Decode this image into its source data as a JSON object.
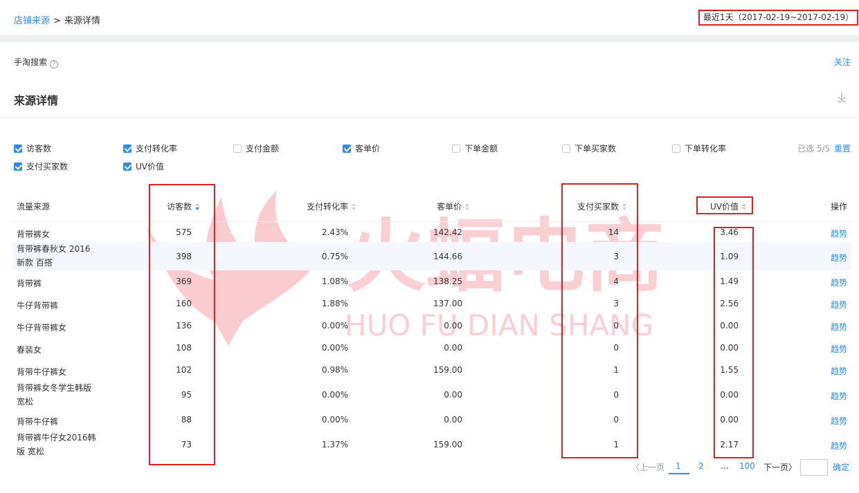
{
  "breadcrumb": {
    "parent": "店铺来源",
    "separator": ">",
    "current": "来源详情"
  },
  "date_range": "最近1天（2017-02-19~2017-02-19）",
  "section": {
    "name": "手淘搜索",
    "help": "?",
    "follow": "关注"
  },
  "title": "来源详情",
  "metrics": [
    {
      "label": "访客数",
      "checked": true
    },
    {
      "label": "支付转化率",
      "checked": true
    },
    {
      "label": "支付金额",
      "checked": false
    },
    {
      "label": "客单价",
      "checked": true
    },
    {
      "label": "下单金额",
      "checked": false
    },
    {
      "label": "下单买家数",
      "checked": false
    },
    {
      "label": "下单转化率",
      "checked": false
    },
    {
      "label": "支付买家数",
      "checked": true
    },
    {
      "label": "UV价值",
      "checked": true
    }
  ],
  "selected_count": "已选 5/5",
  "reset": "重置",
  "columns": [
    "流量来源",
    "访客数",
    "支付转化率",
    "客单价",
    "支付买家数",
    "UV价值",
    "操作"
  ],
  "rows": [
    {
      "source": "背带裤女",
      "visitors": "575",
      "conv": "2.43%",
      "aov": "142.42",
      "buyers": "14",
      "uv": "3.46",
      "action": "趋势"
    },
    {
      "source": "背带裤春秋女 2016 新款 百搭",
      "visitors": "398",
      "conv": "0.75%",
      "aov": "144.66",
      "buyers": "3",
      "uv": "1.09",
      "action": "趋势"
    },
    {
      "source": "背带裤",
      "visitors": "369",
      "conv": "1.08%",
      "aov": "138.25",
      "buyers": "4",
      "uv": "1.49",
      "action": "趋势"
    },
    {
      "source": "牛仔背带裤",
      "visitors": "160",
      "conv": "1.88%",
      "aov": "137.00",
      "buyers": "3",
      "uv": "2.56",
      "action": "趋势"
    },
    {
      "source": "牛仔背带裤女",
      "visitors": "136",
      "conv": "0.00%",
      "aov": "0.00",
      "buyers": "0",
      "uv": "0.00",
      "action": "趋势"
    },
    {
      "source": "春装女",
      "visitors": "108",
      "conv": "0.00%",
      "aov": "0.00",
      "buyers": "0",
      "uv": "0.00",
      "action": "趋势"
    },
    {
      "source": "背带牛仔裤女",
      "visitors": "102",
      "conv": "0.98%",
      "aov": "159.00",
      "buyers": "1",
      "uv": "1.55",
      "action": "趋势"
    },
    {
      "source": "背带裤女冬学生韩版 宽松",
      "visitors": "95",
      "conv": "0.00%",
      "aov": "0.00",
      "buyers": "0",
      "uv": "0.00",
      "action": "趋势"
    },
    {
      "source": "背带牛仔裤",
      "visitors": "88",
      "conv": "0.00%",
      "aov": "0.00",
      "buyers": "0",
      "uv": "0.00",
      "action": "趋势"
    },
    {
      "source": "背带裤牛仔女2016韩版 宽松",
      "visitors": "73",
      "conv": "1.37%",
      "aov": "159.00",
      "buyers": "1",
      "uv": "2.17",
      "action": "趋势"
    }
  ],
  "pagination": {
    "prev": "〈上一页",
    "pages": [
      "1",
      "2",
      "...",
      "100"
    ],
    "current": "1",
    "next": "下一页〉",
    "go": "确定"
  },
  "watermark": {
    "cn": "火蝠电商",
    "en": "HUO FU DIAN SHANG",
    "color": "#f5a0a8"
  },
  "colors": {
    "accent": "#2d8cf0",
    "highlight": "#e02020"
  }
}
